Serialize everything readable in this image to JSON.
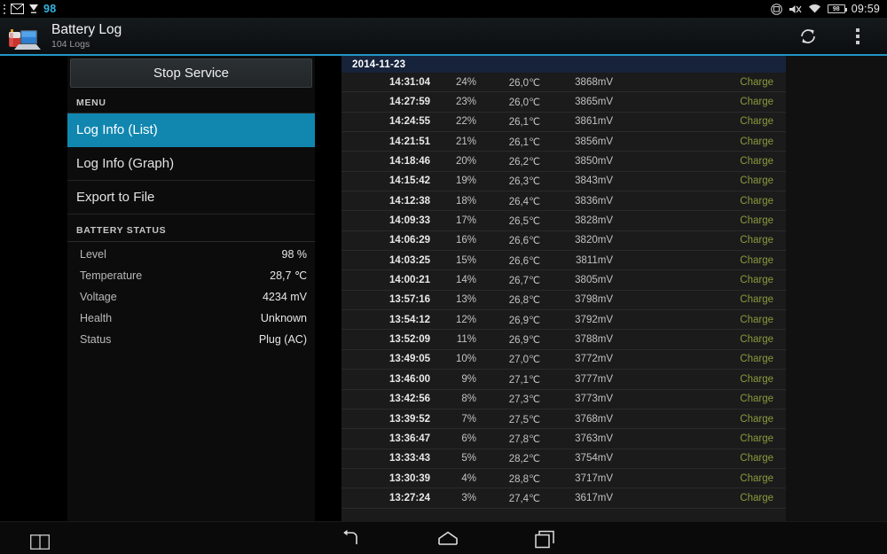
{
  "statusbar": {
    "notif_dots_icon": "overflow-dots-icon",
    "mail_icon": "gmail-icon",
    "download_icon": "download-arrow-icon",
    "notif_count": "98",
    "screenshot_icon": "screen-capture-icon",
    "mute_icon": "volume-muted-icon",
    "wifi_icon": "wifi-icon",
    "battery_level": "98",
    "time": "09:59"
  },
  "appbar": {
    "icon": "battery-laptop-icon",
    "title": "Battery Log",
    "subtitle": "104 Logs",
    "refresh_icon": "refresh-icon",
    "overflow_icon": "overflow-menu-icon"
  },
  "sidebar": {
    "service_button": "Stop Service",
    "menu_header": "MENU",
    "menu_items": [
      {
        "label": "Log Info (List)",
        "active": true
      },
      {
        "label": "Log Info (Graph)",
        "active": false
      },
      {
        "label": "Export to File",
        "active": false
      }
    ],
    "status_header": "BATTERY STATUS",
    "status_rows": [
      {
        "label": "Level",
        "value": "98 %"
      },
      {
        "label": "Temperature",
        "value": "28,7 ℃"
      },
      {
        "label": "Voltage",
        "value": "4234 mV"
      },
      {
        "label": "Health",
        "value": "Unknown"
      },
      {
        "label": "Status",
        "value": "Plug (AC)"
      }
    ]
  },
  "loglist": {
    "date_header": "2014-11-23",
    "rows": [
      {
        "time": "14:31:04",
        "percent": "24%",
        "temp": "26,0℃",
        "voltage": "3868mV",
        "state": "Charge"
      },
      {
        "time": "14:27:59",
        "percent": "23%",
        "temp": "26,0℃",
        "voltage": "3865mV",
        "state": "Charge"
      },
      {
        "time": "14:24:55",
        "percent": "22%",
        "temp": "26,1℃",
        "voltage": "3861mV",
        "state": "Charge"
      },
      {
        "time": "14:21:51",
        "percent": "21%",
        "temp": "26,1℃",
        "voltage": "3856mV",
        "state": "Charge"
      },
      {
        "time": "14:18:46",
        "percent": "20%",
        "temp": "26,2℃",
        "voltage": "3850mV",
        "state": "Charge"
      },
      {
        "time": "14:15:42",
        "percent": "19%",
        "temp": "26,3℃",
        "voltage": "3843mV",
        "state": "Charge"
      },
      {
        "time": "14:12:38",
        "percent": "18%",
        "temp": "26,4℃",
        "voltage": "3836mV",
        "state": "Charge"
      },
      {
        "time": "14:09:33",
        "percent": "17%",
        "temp": "26,5℃",
        "voltage": "3828mV",
        "state": "Charge"
      },
      {
        "time": "14:06:29",
        "percent": "16%",
        "temp": "26,6℃",
        "voltage": "3820mV",
        "state": "Charge"
      },
      {
        "time": "14:03:25",
        "percent": "15%",
        "temp": "26,6℃",
        "voltage": "3811mV",
        "state": "Charge"
      },
      {
        "time": "14:00:21",
        "percent": "14%",
        "temp": "26,7℃",
        "voltage": "3805mV",
        "state": "Charge"
      },
      {
        "time": "13:57:16",
        "percent": "13%",
        "temp": "26,8℃",
        "voltage": "3798mV",
        "state": "Charge"
      },
      {
        "time": "13:54:12",
        "percent": "12%",
        "temp": "26,9℃",
        "voltage": "3792mV",
        "state": "Charge"
      },
      {
        "time": "13:52:09",
        "percent": "11%",
        "temp": "26,9℃",
        "voltage": "3788mV",
        "state": "Charge"
      },
      {
        "time": "13:49:05",
        "percent": "10%",
        "temp": "27,0℃",
        "voltage": "3772mV",
        "state": "Charge"
      },
      {
        "time": "13:46:00",
        "percent": "9%",
        "temp": "27,1℃",
        "voltage": "3777mV",
        "state": "Charge"
      },
      {
        "time": "13:42:56",
        "percent": "8%",
        "temp": "27,3℃",
        "voltage": "3773mV",
        "state": "Charge"
      },
      {
        "time": "13:39:52",
        "percent": "7%",
        "temp": "27,5℃",
        "voltage": "3768mV",
        "state": "Charge"
      },
      {
        "time": "13:36:47",
        "percent": "6%",
        "temp": "27,8℃",
        "voltage": "3763mV",
        "state": "Charge"
      },
      {
        "time": "13:33:43",
        "percent": "5%",
        "temp": "28,2℃",
        "voltage": "3754mV",
        "state": "Charge"
      },
      {
        "time": "13:30:39",
        "percent": "4%",
        "temp": "28,8℃",
        "voltage": "3717mV",
        "state": "Charge"
      },
      {
        "time": "13:27:24",
        "percent": "3%",
        "temp": "27,4℃",
        "voltage": "3617mV",
        "state": "Charge"
      }
    ]
  },
  "navbar": {
    "split_icon": "split-screen-icon",
    "back_icon": "back-icon",
    "home_icon": "home-icon",
    "recents_icon": "recent-apps-icon"
  },
  "colors": {
    "accent": "#1187b0",
    "accent_line": "#2196c4",
    "date_band": "#16233a",
    "state_text": "#8a9a3c",
    "notif_blue": "#33b5e5"
  }
}
